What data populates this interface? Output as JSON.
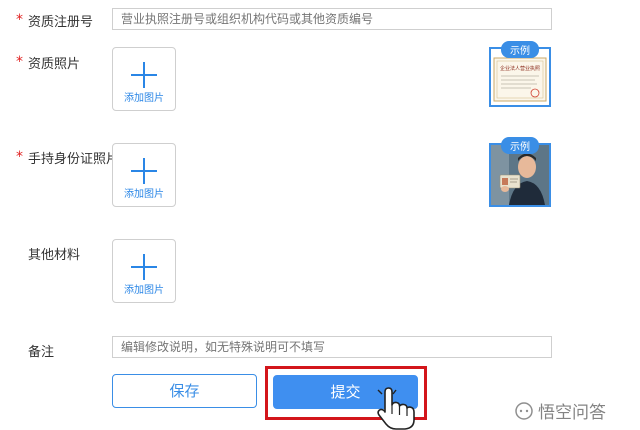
{
  "form": {
    "registration_number": {
      "required_mark": "*",
      "label": "资质注册号",
      "placeholder": "营业执照注册号或组织机构代码或其他资质编号"
    },
    "qualification_photo": {
      "required_mark": "*",
      "label": "资质照片",
      "upload_label": "添加图片",
      "sample_tag": "示例",
      "sample_caption": "企业法人营业执照"
    },
    "id_photo": {
      "required_mark": "*",
      "label": "手持身份证照片",
      "upload_label": "添加图片",
      "sample_tag": "示例"
    },
    "other_materials": {
      "label": "其他材料",
      "upload_label": "添加图片"
    },
    "remarks": {
      "label": "备注",
      "placeholder": "编辑修改说明，如无特殊说明可不填写"
    }
  },
  "actions": {
    "save_label": "保存",
    "submit_label": "提交"
  },
  "watermark": {
    "text": "悟空问答"
  },
  "colors": {
    "accent": "#3f8ff0",
    "required": "#e02020",
    "highlight": "#d3161b"
  }
}
